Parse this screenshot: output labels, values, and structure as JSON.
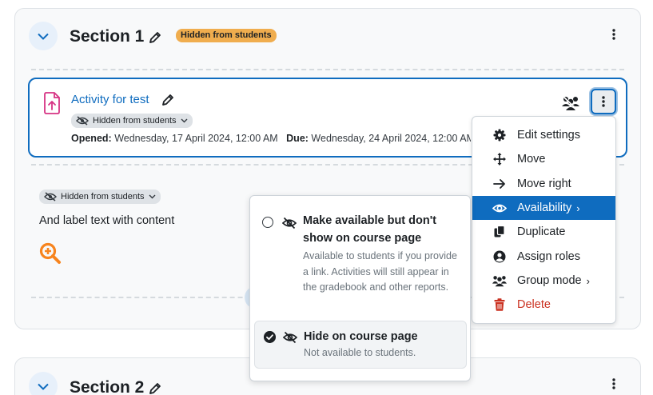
{
  "section1": {
    "title": "Section 1",
    "badge": "Hidden from students",
    "activity": {
      "name": "Activity for test",
      "visibility_pill": "Hidden from students",
      "opened_label": "Opened:",
      "opened_value": "Wednesday, 17 April 2024, 12:00 AM",
      "due_label": "Due:",
      "due_value": "Wednesday, 24 April 2024, 12:00 AM"
    },
    "label_item": {
      "visibility_pill": "Hidden from students",
      "text": "And label text with content"
    }
  },
  "section2": {
    "title": "Section 2"
  },
  "action_menu": {
    "items": [
      {
        "label": "Edit settings",
        "icon": "gear-icon"
      },
      {
        "label": "Move",
        "icon": "move-arrows-icon"
      },
      {
        "label": "Move right",
        "icon": "arrow-right-icon"
      },
      {
        "label": "Availability",
        "icon": "eye-icon",
        "chevron": "›",
        "active": true
      },
      {
        "label": "Duplicate",
        "icon": "copy-icon"
      },
      {
        "label": "Assign roles",
        "icon": "user-circle-icon"
      },
      {
        "label": "Group mode",
        "icon": "users-icon",
        "chevron": "›"
      },
      {
        "label": "Delete",
        "icon": "trash-icon",
        "danger": true
      }
    ]
  },
  "availability_submenu": {
    "option1": {
      "title": "Make available but don't show on course page",
      "description": "Available to students if you provide a link. Activities will still appear in the gradebook and other reports.",
      "selected": false
    },
    "option2": {
      "title": "Hide on course page",
      "description": "Not available to students.",
      "selected": true
    }
  },
  "colors": {
    "primary": "#0f6cbf",
    "warning_badge": "#f0ad4e",
    "danger": "#ca3120",
    "assignment_icon": "#d63384",
    "zoom_icon": "#f7841e"
  }
}
